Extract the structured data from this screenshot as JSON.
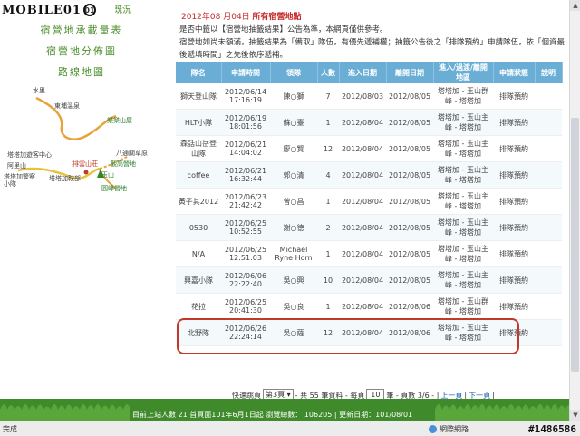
{
  "watermark": {
    "logo": "MOBILE01",
    "badge": "01"
  },
  "sidebar": {
    "top_link": "既況",
    "menu": [
      {
        "label": "宿營地承載量表"
      },
      {
        "label": "宿營地分佈圖"
      },
      {
        "label": "路線地圖"
      }
    ],
    "map_labels": {
      "shuili": "水里",
      "dongpu": "東埔溫泉",
      "lele": "樂樂山屋",
      "tataka_land": "塔塔加遊客中心",
      "alishan": "阿里山",
      "tataka_police": "塔塔加警察小隊",
      "tataka_anbu": "塔塔加鞍部",
      "paiyun": "排雲山莊",
      "yushan": "玉山",
      "batongguan": "八通關草原",
      "guangao": "觀高營地",
      "yuanfeng": "圓峰營地"
    }
  },
  "main": {
    "date_prefix": "2012年08 月04日",
    "date_suffix": "所有宿營地點",
    "desc_line1": "是否中籤以【宿營地抽籤結果】公告為準，本網頁僅供參考。",
    "desc_line2": "宿營地如尚未額滿，抽籤結果為「備取」隊伍，有優先遞補權；抽籤公告後之「排隊預約」申請隊伍，依「個資最後遞填時間」之先後依序遞補。",
    "columns": [
      "隊名",
      "申請時間",
      "領隊",
      "人數",
      "進入日期",
      "離開日期",
      "進入/過渡/離開地區",
      "申請狀態",
      "說明"
    ],
    "rows": [
      {
        "team": "獅天登山隊",
        "time1": "2012/06/14",
        "time2": "17:16:19",
        "leader": "陳○獅",
        "count": "7",
        "enter": "2012/08/03",
        "leave": "2012/08/05",
        "route": "塔塔加 - 玉山群峰 - 塔塔加",
        "status": "排隊預約"
      },
      {
        "team": "HLT小隊",
        "time1": "2012/06/19",
        "time2": "18:01:56",
        "leader": "蘇○臺",
        "count": "1",
        "enter": "2012/08/04",
        "leave": "2012/08/05",
        "route": "塔塔加 - 玉山主峰 - 塔塔加",
        "status": "排隊預約"
      },
      {
        "team": "森話山岳登山隊",
        "time1": "2012/06/21",
        "time2": "14:04:02",
        "leader": "廖○賢",
        "count": "12",
        "enter": "2012/08/04",
        "leave": "2012/08/05",
        "route": "塔塔加 - 玉山主峰 - 塔塔加",
        "status": "排隊預約"
      },
      {
        "team": "coffee",
        "time1": "2012/06/21",
        "time2": "16:32:44",
        "leader": "郭○清",
        "count": "4",
        "enter": "2012/08/04",
        "leave": "2012/08/05",
        "route": "塔塔加 - 玉山主峰 - 塔塔加",
        "status": "排隊預約"
      },
      {
        "team": "黃子其2012",
        "time1": "2012/06/23",
        "time2": "21:42:42",
        "leader": "曾○昌",
        "count": "1",
        "enter": "2012/08/04",
        "leave": "2012/08/05",
        "route": "塔塔加 - 玉山主峰 - 塔塔加",
        "status": "排隊預約"
      },
      {
        "team": "0530",
        "time1": "2012/06/25",
        "time2": "10:52:55",
        "leader": "謝○德",
        "count": "2",
        "enter": "2012/08/04",
        "leave": "2012/08/05",
        "route": "塔塔加 - 玉山主峰 - 塔塔加",
        "status": "排隊預約"
      },
      {
        "team": "N/A",
        "time1": "2012/06/25",
        "time2": "12:51:03",
        "leader": "Michael Ryne Horn",
        "count": "1",
        "enter": "2012/08/04",
        "leave": "2012/08/05",
        "route": "塔塔加 - 玉山主峰 - 塔塔加",
        "status": "排隊預約"
      },
      {
        "team": "興嘉小隊",
        "time1": "2012/06/06",
        "time2": "22:22:40",
        "leader": "吳○興",
        "count": "10",
        "enter": "2012/08/04",
        "leave": "2012/08/05",
        "route": "塔塔加 - 玉山主峰 - 塔塔加",
        "status": "排隊預約"
      },
      {
        "team": "花拉",
        "time1": "2012/06/25",
        "time2": "20:41:30",
        "leader": "吳○良",
        "count": "1",
        "enter": "2012/08/04",
        "leave": "2012/08/06",
        "route": "塔塔加 - 玉山群峰 - 塔塔加",
        "status": "排隊預約"
      },
      {
        "team": "北野隊",
        "time1": "2012/06/26",
        "time2": "22:24:14",
        "leader": "吳○薩",
        "count": "12",
        "enter": "2012/08/04",
        "leave": "2012/08/06",
        "route": "塔塔加 - 玉山主峰 - 塔塔加",
        "status": "排隊預約"
      }
    ]
  },
  "pager": {
    "jump_label": "快速跳頁",
    "page_select": "第3頁",
    "summary": "- 共 55 筆資料 - 每頁",
    "per_page": "10",
    "page_info": "筆 - 頁數 3/6 - |",
    "prev": "上一頁",
    "sep": "|",
    "next": "下一頁",
    "end": "|"
  },
  "footer": {
    "text": "目前上站人數 21 首頁面101年6月1日起 瀏覽總數： 106205 | 更新日期：101/08/01"
  },
  "statusbar": {
    "status": "完成",
    "zone": "網際網路",
    "tag": "#1486586"
  },
  "colors": {
    "header_bg": "#6aaed6",
    "highlight": "#c0392b",
    "grass": "#3f8a2b",
    "link": "#2d7fbf"
  }
}
